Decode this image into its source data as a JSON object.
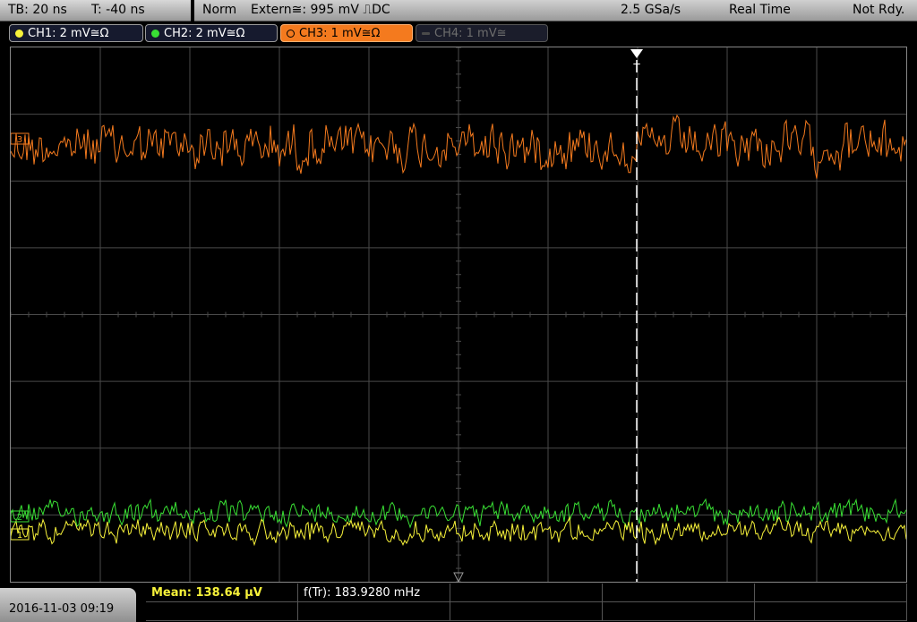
{
  "topbar": {
    "timebase": "TB: 20 ns",
    "trigger_time": "T: -40 ns",
    "trigger_mode": "Norm",
    "trigger_source": "Extern≅: 995 mV ⎍DC",
    "sample_rate": "2.5 GSa/s",
    "acq_mode": "Real Time",
    "status": "Not Rdy."
  },
  "channels": [
    {
      "label": "CH1: 2 mV≅Ω",
      "color": "#f7f23a",
      "state": "on"
    },
    {
      "label": "CH2: 2 mV≅Ω",
      "color": "#39e034",
      "state": "on"
    },
    {
      "label": "CH3: 1 mV≅Ω",
      "color": "#f47a1e",
      "state": "active"
    },
    {
      "label": "CH4: 1 mV≅",
      "color": "#6d6d6d",
      "state": "off"
    }
  ],
  "markers": {
    "ch3": "3",
    "ch2": "2",
    "ch1": "1",
    "trigger": "T"
  },
  "measurements": {
    "mean": "Mean: 138.64 µV",
    "freq": "f(Tr): 183.9280 mHz"
  },
  "datetime": "2016-11-03 09:19",
  "colors": {
    "grid": "#4a4a4a",
    "ch1": "#f7f23a",
    "ch2": "#39e034",
    "ch3": "#f47a1e",
    "trigger_line": "#ffffff",
    "measure_label": "#f7f23a"
  }
}
